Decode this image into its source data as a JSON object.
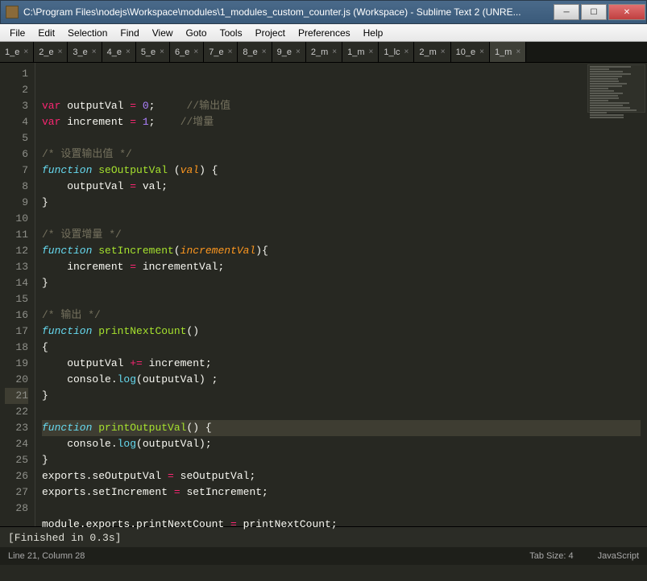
{
  "window": {
    "title": "C:\\Program Files\\nodejs\\Workspace\\modules\\1_modules_custom_counter.js (Workspace) - Sublime Text 2 (UNRE..."
  },
  "menubar": [
    "File",
    "Edit",
    "Selection",
    "Find",
    "View",
    "Goto",
    "Tools",
    "Project",
    "Preferences",
    "Help"
  ],
  "tabs": [
    {
      "label": "1_e"
    },
    {
      "label": "2_e"
    },
    {
      "label": "3_e"
    },
    {
      "label": "4_e"
    },
    {
      "label": "5_e"
    },
    {
      "label": "6_e"
    },
    {
      "label": "7_e"
    },
    {
      "label": "8_e"
    },
    {
      "label": "9_e"
    },
    {
      "label": "2_m"
    },
    {
      "label": "1_m"
    },
    {
      "label": "1_lc"
    },
    {
      "label": "2_m"
    },
    {
      "label": "10_e"
    },
    {
      "label": "1_m"
    }
  ],
  "activeTabIndex": 14,
  "lineCount": 28,
  "highlightLine": 21,
  "code": [
    [
      {
        "c": "stor",
        "t": "var"
      },
      {
        "t": " outputVal "
      },
      {
        "c": "op",
        "t": "="
      },
      {
        "t": " "
      },
      {
        "c": "num",
        "t": "0"
      },
      {
        "t": ";     "
      },
      {
        "c": "cmt",
        "t": "//输出值"
      }
    ],
    [
      {
        "c": "stor",
        "t": "var"
      },
      {
        "t": " increment "
      },
      {
        "c": "op",
        "t": "="
      },
      {
        "t": " "
      },
      {
        "c": "num",
        "t": "1"
      },
      {
        "t": ";    "
      },
      {
        "c": "cmt",
        "t": "//增量"
      }
    ],
    [],
    [
      {
        "c": "cmt",
        "t": "/* 设置输出值 */"
      }
    ],
    [
      {
        "c": "kw",
        "t": "function"
      },
      {
        "t": " "
      },
      {
        "c": "name",
        "t": "seOutputVal"
      },
      {
        "t": " ("
      },
      {
        "c": "param",
        "t": "val"
      },
      {
        "t": ") {"
      }
    ],
    [
      {
        "t": "    outputVal "
      },
      {
        "c": "op",
        "t": "="
      },
      {
        "t": " val;"
      }
    ],
    [
      {
        "t": "}"
      }
    ],
    [],
    [
      {
        "c": "cmt",
        "t": "/* 设置增量 */"
      }
    ],
    [
      {
        "c": "kw",
        "t": "function"
      },
      {
        "t": " "
      },
      {
        "c": "name",
        "t": "setIncrement"
      },
      {
        "t": "("
      },
      {
        "c": "param",
        "t": "incrementVal"
      },
      {
        "t": "){"
      }
    ],
    [
      {
        "t": "    increment "
      },
      {
        "c": "op",
        "t": "="
      },
      {
        "t": " incrementVal;"
      }
    ],
    [
      {
        "t": "}"
      }
    ],
    [],
    [
      {
        "c": "cmt",
        "t": "/* 输出 */"
      }
    ],
    [
      {
        "c": "kw",
        "t": "function"
      },
      {
        "t": " "
      },
      {
        "c": "name",
        "t": "printNextCount"
      },
      {
        "t": "()"
      }
    ],
    [
      {
        "t": "{"
      }
    ],
    [
      {
        "t": "    outputVal "
      },
      {
        "c": "op",
        "t": "+="
      },
      {
        "t": " increment;"
      }
    ],
    [
      {
        "t": "    console."
      },
      {
        "c": "fn",
        "t": "log"
      },
      {
        "t": "(outputVal) ;"
      }
    ],
    [
      {
        "t": "}"
      }
    ],
    [],
    [
      {
        "c": "kw",
        "t": "function"
      },
      {
        "t": " "
      },
      {
        "c": "name",
        "t": "printOutputVal"
      },
      {
        "t": "() {"
      }
    ],
    [
      {
        "t": "    console."
      },
      {
        "c": "fn",
        "t": "log"
      },
      {
        "t": "(outputVal);"
      }
    ],
    [
      {
        "t": "}"
      }
    ],
    [
      {
        "t": "exports.seOutputVal "
      },
      {
        "c": "op",
        "t": "="
      },
      {
        "t": " seOutputVal;"
      }
    ],
    [
      {
        "t": "exports.setIncrement "
      },
      {
        "c": "op",
        "t": "="
      },
      {
        "t": " setIncrement;"
      }
    ],
    [],
    [
      {
        "t": "module.exports.printNextCount "
      },
      {
        "c": "op",
        "t": "="
      },
      {
        "t": " printNextCount;"
      }
    ],
    []
  ],
  "console": "[Finished in 0.3s]",
  "status": {
    "left": "Line 21, Column 28",
    "tabsize": "Tab Size: 4",
    "lang": "JavaScript"
  }
}
